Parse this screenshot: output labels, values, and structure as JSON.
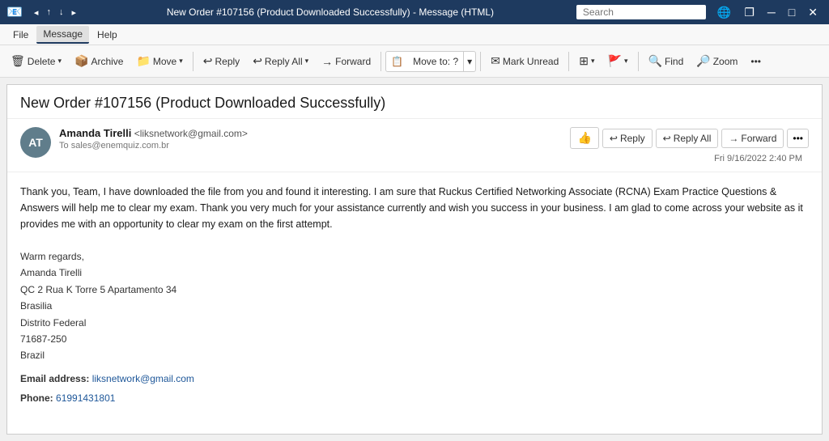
{
  "titlebar": {
    "back_icon": "◂",
    "forward_icon": "▸",
    "down_icon": "▾",
    "title": "New Order #107156 (Product Downloaded Successfully) - Message (HTML)",
    "search_placeholder": "Search",
    "globe_icon": "🌐",
    "restore_icon": "❐",
    "minimize_icon": "─",
    "maximize_icon": "□",
    "close_icon": "✕"
  },
  "menubar": {
    "items": [
      "File",
      "Message",
      "Help"
    ]
  },
  "toolbar": {
    "delete_label": "Delete",
    "archive_label": "Archive",
    "move_label": "Move",
    "move_arrow": "▾",
    "reply_label": "Reply",
    "reply_all_label": "Reply All",
    "forward_label": "Forward",
    "moveto_label": "Move to: ?",
    "moveto_arrow": "▾",
    "mark_unread_label": "Mark Unread",
    "find_label": "Find",
    "zoom_label": "Zoom",
    "more_icon": "•••"
  },
  "message": {
    "subject": "New Order #107156 (Product Downloaded Successfully)",
    "sender_initials": "AT",
    "sender_name": "Amanda Tirelli",
    "sender_email": "<liksnetwork@gmail.com>",
    "sender_to_label": "To",
    "sender_to_address": "sales@enemquiz.com.br",
    "date": "Fri 9/16/2022 2:40 PM",
    "reply_label": "Reply",
    "reply_all_label": "Reply All",
    "forward_label": "Forward",
    "body_text": "Thank you, Team, I have downloaded the file from you and found it interesting.  I am sure that Ruckus Certified Networking Associate (RCNA) Exam Practice Questions & Answers will help me to clear my exam. Thank you very much for your assistance currently and wish you success in your business. I am glad to come across your website as it provides me with an opportunity to clear my exam on the first attempt.",
    "signature": {
      "greeting": "Warm regards,",
      "name": "Amanda Tirelli",
      "address1": "QC 2 Rua K Torre 5 Apartamento 34",
      "city": "Brasilia",
      "state": "Distrito Federal",
      "zip": "71687-250",
      "country": "Brazil",
      "email_label": "Email address:",
      "email_value": "liksnetwork@gmail.com",
      "phone_label": "Phone:",
      "phone_value": "61991431801"
    }
  }
}
